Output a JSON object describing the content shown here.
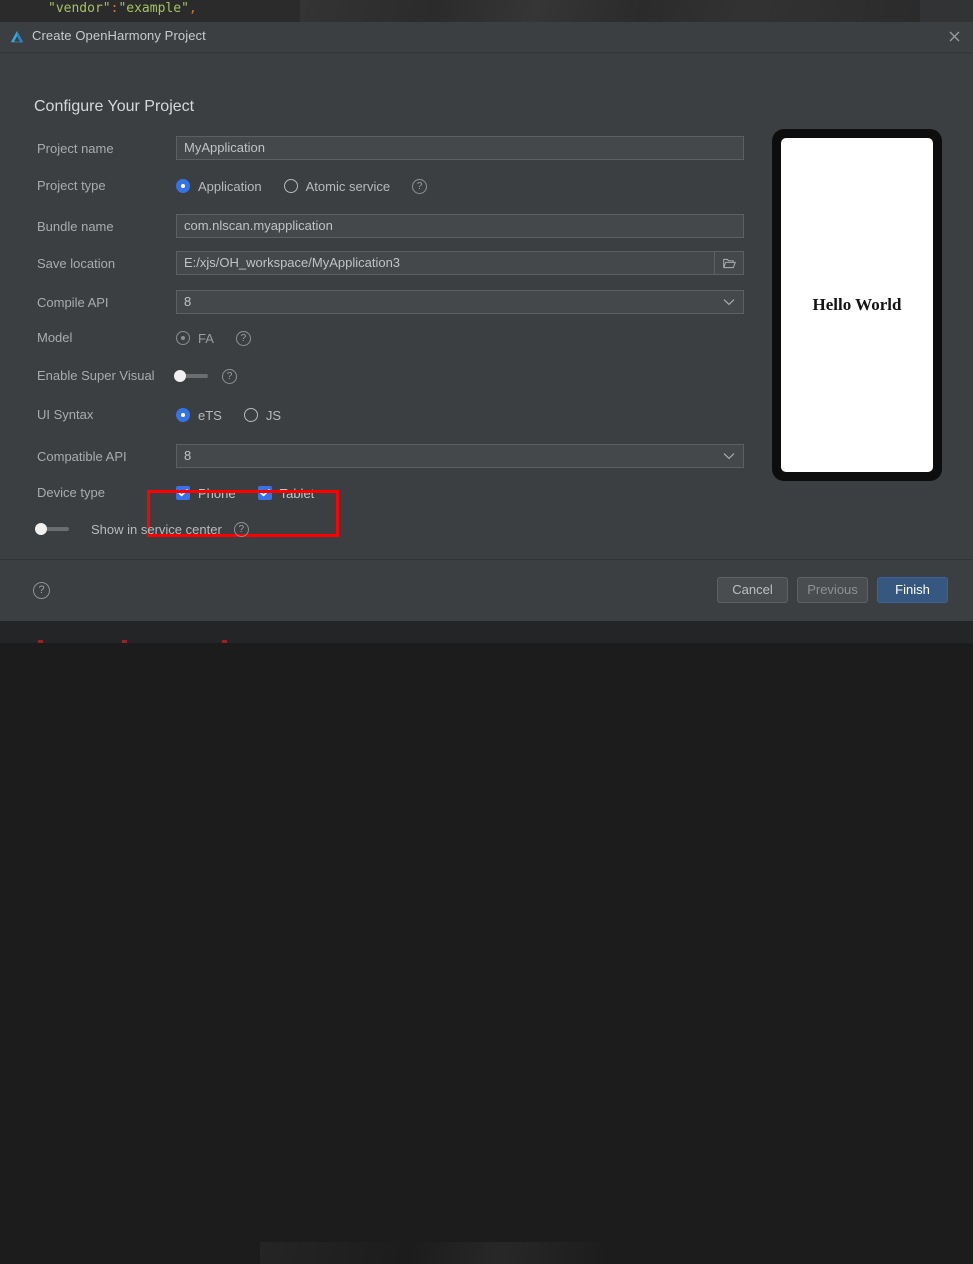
{
  "background": {
    "editor_code_prefix": "\"vendor\"",
    "editor_code_sep": ":",
    "editor_code_value": "\"example\"",
    "editor_code_comma": ","
  },
  "dialog": {
    "title": "Create OpenHarmony Project",
    "logo_icon": "deveco-triangle-icon",
    "close_icon": "close-icon",
    "page_title": "Configure Your Project"
  },
  "form": {
    "project_name": {
      "label": "Project name",
      "value": "MyApplication"
    },
    "project_type": {
      "label": "Project type",
      "options": [
        {
          "label": "Application",
          "selected": true
        },
        {
          "label": "Atomic service",
          "selected": false
        }
      ],
      "help_icon": "help-icon"
    },
    "bundle_name": {
      "label": "Bundle name",
      "value": "com.nlscan.myapplication"
    },
    "save_location": {
      "label": "Save location",
      "value": "E:/xjs/OH_workspace/MyApplication3",
      "browse_icon": "folder-icon"
    },
    "compile_api": {
      "label": "Compile API",
      "value": "8",
      "arrow_icon": "chevron-down-icon"
    },
    "model": {
      "label": "Model",
      "options": [
        {
          "label": "FA",
          "selected": true,
          "disabled": true
        }
      ],
      "help_icon": "help-icon"
    },
    "enable_super_visual": {
      "label": "Enable Super Visual",
      "toggle_on": false,
      "help_icon": "help-icon"
    },
    "ui_syntax": {
      "label": "UI Syntax",
      "options": [
        {
          "label": "eTS",
          "selected": true
        },
        {
          "label": "JS",
          "selected": false
        }
      ]
    },
    "compatible_api": {
      "label": "Compatible API",
      "value": "8",
      "arrow_icon": "chevron-down-icon"
    },
    "device_type": {
      "label": "Device type",
      "options": [
        {
          "label": "Phone",
          "checked": true
        },
        {
          "label": "Tablet",
          "checked": true
        }
      ],
      "highlight_color": "#fe0000"
    },
    "show_in_service_center": {
      "label": "Show in service center",
      "toggle_on": false,
      "help_icon": "help-icon"
    }
  },
  "preview": {
    "text": "Hello World"
  },
  "footer": {
    "help_icon": "help-icon",
    "help_glyph": "?",
    "cancel_label": "Cancel",
    "previous_label": "Previous",
    "finish_label": "Finish",
    "primary_color": "#365880"
  }
}
